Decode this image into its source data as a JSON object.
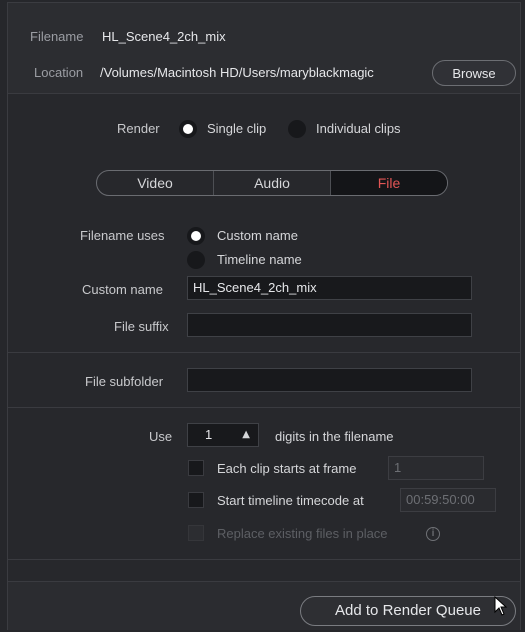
{
  "location_section": {
    "filename_label": "Filename",
    "filename_value": "HL_Scene4_2ch_mix",
    "location_label": "Location",
    "location_value": "/Volumes/Macintosh HD/Users/maryblackmagic",
    "browse_label": "Browse"
  },
  "render": {
    "label": "Render",
    "single_clip": "Single clip",
    "individual_clips": "Individual clips",
    "selected": "Single clip"
  },
  "tabs": [
    "Video",
    "Audio",
    "File"
  ],
  "active_tab": "File",
  "file": {
    "filename_uses_label": "Filename uses",
    "custom_name_option": "Custom name",
    "timeline_name_option": "Timeline name",
    "custom_name_label": "Custom name",
    "custom_name_value": "HL_Scene4_2ch_mix",
    "file_suffix_label": "File suffix",
    "file_suffix_value": "",
    "file_subfolder_label": "File subfolder",
    "file_subfolder_value": "",
    "use_label": "Use",
    "digits_value": "1",
    "digits_suffix": "digits in the filename",
    "each_clip_label": "Each clip starts at frame",
    "each_clip_value": "1",
    "start_tc_label": "Start timeline timecode at",
    "start_tc_value": "00:59:50:00",
    "replace_label": "Replace existing files in place",
    "info_symbol": "i"
  },
  "footer": {
    "add_to_queue_label": "Add to Render Queue"
  },
  "colors": {
    "active_tab_text": "#e25555",
    "panel_bg": "#27282c"
  }
}
